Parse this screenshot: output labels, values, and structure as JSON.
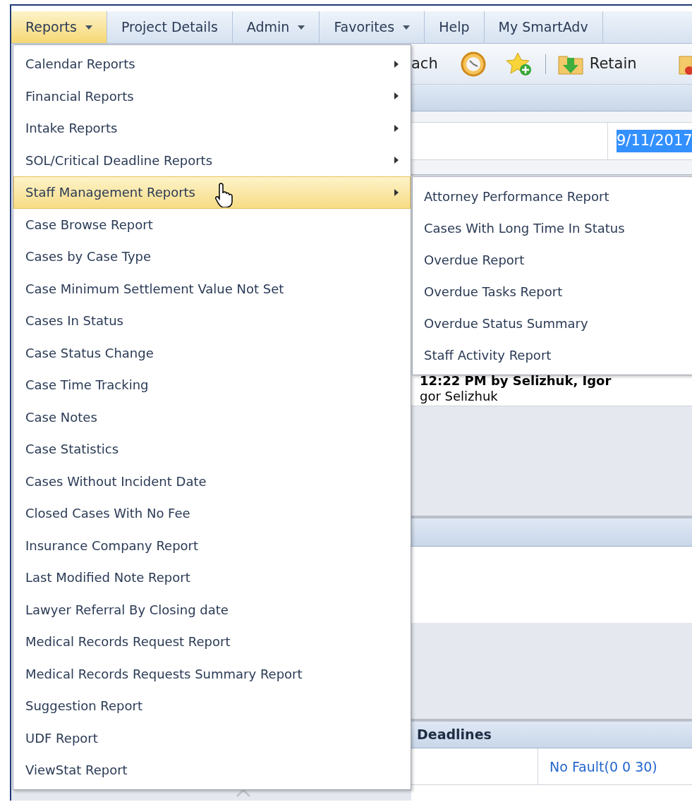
{
  "menu_bar": [
    {
      "label": "Reports",
      "selected": true,
      "has_caret": true
    },
    {
      "label": "Project Details",
      "selected": false,
      "has_caret": false
    },
    {
      "label": "Admin",
      "selected": false,
      "has_caret": true
    },
    {
      "label": "Favorites",
      "selected": false,
      "has_caret": true
    },
    {
      "label": "Help",
      "selected": false,
      "has_caret": false
    },
    {
      "label": "My SmartAdv",
      "selected": false,
      "has_caret": false
    }
  ],
  "toolbar": {
    "partial_label": "ach",
    "retain_label": "Retain"
  },
  "date_field": {
    "value": "9/11/2017",
    "selected": true
  },
  "activity": {
    "line_1": "12:22 PM by Selizhuk, Igor",
    "line_2": "gor Selizhuk"
  },
  "deadlines": {
    "title": "Deadlines",
    "link": "No Fault(0 0 30)"
  },
  "reports_menu": [
    {
      "label": "Calendar Reports",
      "has_submenu": true,
      "selected": false
    },
    {
      "label": "Financial Reports",
      "has_submenu": true,
      "selected": false
    },
    {
      "label": "Intake Reports",
      "has_submenu": true,
      "selected": false
    },
    {
      "label": "SOL/Critical Deadline Reports",
      "has_submenu": true,
      "selected": false
    },
    {
      "label": "Staff Management Reports",
      "has_submenu": true,
      "selected": true
    },
    {
      "label": "Case Browse Report",
      "has_submenu": false,
      "selected": false
    },
    {
      "label": "Cases by Case Type",
      "has_submenu": false,
      "selected": false
    },
    {
      "label": "Case Minimum Settlement Value Not Set",
      "has_submenu": false,
      "selected": false
    },
    {
      "label": "Cases In Status",
      "has_submenu": false,
      "selected": false
    },
    {
      "label": "Case Status Change",
      "has_submenu": false,
      "selected": false
    },
    {
      "label": "Case Time Tracking",
      "has_submenu": false,
      "selected": false
    },
    {
      "label": "Case Notes",
      "has_submenu": false,
      "selected": false
    },
    {
      "label": "Case Statistics",
      "has_submenu": false,
      "selected": false
    },
    {
      "label": "Cases Without Incident Date",
      "has_submenu": false,
      "selected": false
    },
    {
      "label": "Closed Cases With No Fee",
      "has_submenu": false,
      "selected": false
    },
    {
      "label": "Insurance Company Report",
      "has_submenu": false,
      "selected": false
    },
    {
      "label": "Last Modified Note Report",
      "has_submenu": false,
      "selected": false
    },
    {
      "label": "Lawyer Referral By Closing date",
      "has_submenu": false,
      "selected": false
    },
    {
      "label": "Medical Records Request Report",
      "has_submenu": false,
      "selected": false
    },
    {
      "label": "Medical Records Requests Summary Report",
      "has_submenu": false,
      "selected": false
    },
    {
      "label": "Suggestion Report",
      "has_submenu": false,
      "selected": false
    },
    {
      "label": "UDF Report",
      "has_submenu": false,
      "selected": false
    },
    {
      "label": "ViewStat Report",
      "has_submenu": false,
      "selected": false
    }
  ],
  "staff_submenu": [
    {
      "label": "Attorney Performance Report"
    },
    {
      "label": "Cases With Long Time In Status"
    },
    {
      "label": "Overdue Report"
    },
    {
      "label": "Overdue Tasks Report"
    },
    {
      "label": "Overdue Status Summary"
    },
    {
      "label": "Staff Activity Report"
    }
  ]
}
